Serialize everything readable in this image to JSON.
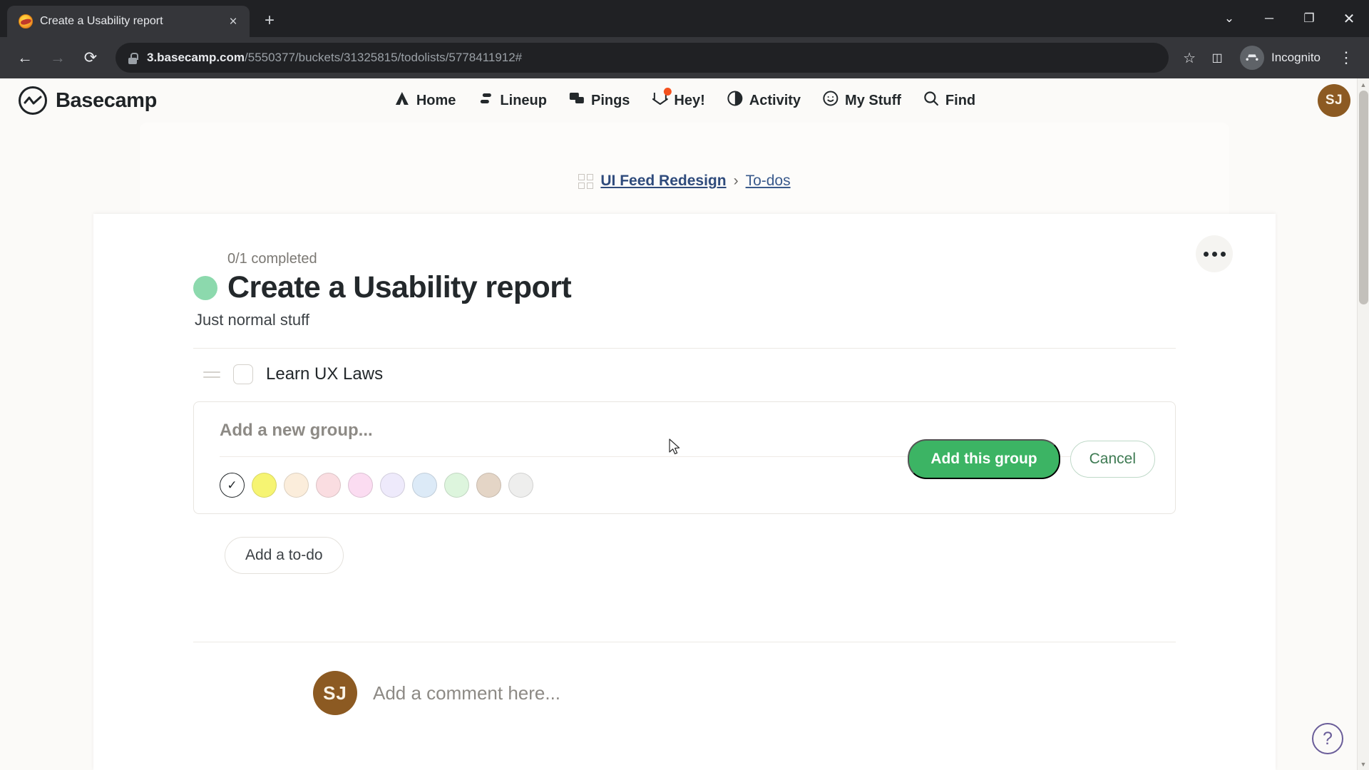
{
  "browser": {
    "tab": {
      "title": "Create a Usability report",
      "favicon": "basecamp-favicon",
      "close_label": "×"
    },
    "new_tab_label": "+",
    "window_controls": {
      "minimize_all": "⌄",
      "minimize": "─",
      "maximize": "❐",
      "close": "✕"
    },
    "back_label": "←",
    "forward_label": "→",
    "reload_label": "⟳",
    "url_host": "3.basecamp.com",
    "url_path": "/5550377/buckets/31325815/todolists/5778411912#",
    "bookmark_label": "☆",
    "side_panel_label": "◫",
    "incognito_label": "Incognito",
    "menu_label": "⋮"
  },
  "app_header": {
    "logo_text": "Basecamp",
    "nav": [
      {
        "label": "Home",
        "icon": "home-icon",
        "badge": false
      },
      {
        "label": "Lineup",
        "icon": "lineup-icon",
        "badge": false
      },
      {
        "label": "Pings",
        "icon": "pings-icon",
        "badge": false
      },
      {
        "label": "Hey!",
        "icon": "hey-inbox-icon",
        "badge": true
      },
      {
        "label": "Activity",
        "icon": "activity-pie-icon",
        "badge": false
      },
      {
        "label": "My Stuff",
        "icon": "smiley-icon",
        "badge": false
      },
      {
        "label": "Find",
        "icon": "search-icon",
        "badge": false
      }
    ],
    "avatar_initials": "SJ",
    "badge_color": "#f4511e"
  },
  "breadcrumb": {
    "icon": "grid-icon",
    "project": "UI Feed Redesign",
    "separator": "›",
    "section": "To-dos"
  },
  "todolist": {
    "more_menu_label": "⋯",
    "completed_count": "0/1 completed",
    "title": "Create a Usability report",
    "title_dot_color": "#8cd9ad",
    "subtitle": "Just normal stuff",
    "items": [
      {
        "label": "Learn UX Laws",
        "checked": false
      }
    ],
    "add_todo_label": "Add a to-do"
  },
  "new_group_form": {
    "placeholder": "Add a new group...",
    "submit_label": "Add this group",
    "cancel_label": "Cancel",
    "selected_swatch_index": 0,
    "selected_mark": "✓",
    "swatches": [
      {
        "name": "white",
        "color": "#ffffff"
      },
      {
        "name": "yellow",
        "color": "#f6f472"
      },
      {
        "name": "peach",
        "color": "#fbeddb"
      },
      {
        "name": "rose",
        "color": "#fadde1"
      },
      {
        "name": "pink",
        "color": "#fbdcf1"
      },
      {
        "name": "lavender",
        "color": "#eeeafb"
      },
      {
        "name": "blue",
        "color": "#dceaf7"
      },
      {
        "name": "green",
        "color": "#ddf5dd"
      },
      {
        "name": "tan",
        "color": "#e4d5c6"
      },
      {
        "name": "gray",
        "color": "#eeeeed"
      }
    ]
  },
  "comment": {
    "avatar_initials": "SJ",
    "placeholder": "Add a comment here..."
  },
  "help": {
    "label": "?",
    "color": "#6a5d99"
  },
  "scrollbar": {
    "up": "▲",
    "down": "▼"
  }
}
